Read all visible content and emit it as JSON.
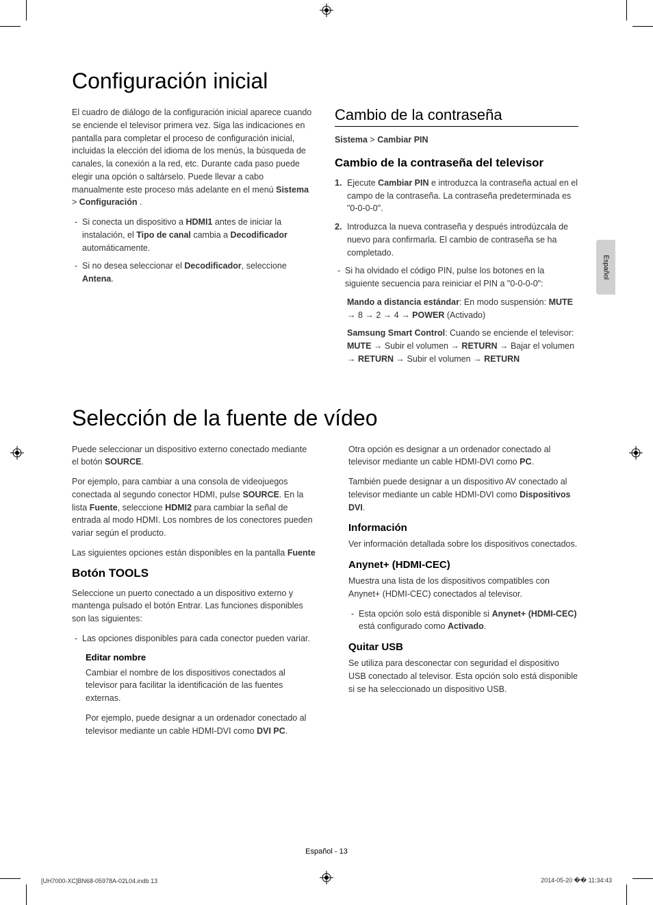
{
  "lang_tab": "Español",
  "section1": {
    "title": "Configuración inicial",
    "left": {
      "intro": "El cuadro de diálogo de la configuración inicial aparece cuando se enciende el televisor primera vez. Siga las indicaciones en pantalla para completar el proceso de configuración inicial, incluidas la elección del idioma de los menús, la búsqueda de canales, la conexión a la red, etc. Durante cada paso puede elegir una opción o saltárselo. Puede llevar a cabo manualmente este proceso más adelante en el menú ",
      "intro_b1": "Sistema",
      "intro_gt": " > ",
      "intro_b2": "Configuración",
      "intro_end": " .",
      "bullet1_a": "Si conecta un dispositivo a ",
      "bullet1_b1": "HDMI1",
      "bullet1_b": " antes de iniciar la instalación, el ",
      "bullet1_b2": "Tipo de canal",
      "bullet1_c": " cambia a ",
      "bullet1_b3": "Decodificador",
      "bullet1_d": " automáticamente.",
      "bullet2_a": "Si no desea seleccionar el ",
      "bullet2_b1": "Decodificador",
      "bullet2_b": ", seleccione ",
      "bullet2_b2": "Antena",
      "bullet2_c": "."
    },
    "right": {
      "h2": "Cambio de la contraseña",
      "crumb_a": "Sistema",
      "crumb_gt": " > ",
      "crumb_b": "Cambiar PIN",
      "h3": "Cambio de la contraseña del televisor",
      "step1_num": "1.",
      "step1_a": "Ejecute ",
      "step1_b1": "Cambiar PIN",
      "step1_b": " e introduzca la contraseña actual en el campo de la contraseña. La contraseña predeterminada es \"0-0-0-0\".",
      "step2_num": "2.",
      "step2_a": "Introduzca la nueva contraseña y después introdúzcala de nuevo para confirmarla. El cambio de contraseña se ha completado.",
      "bullet_a": "Si ha olvidado el código PIN, pulse los botones en la siguiente secuencia para reiniciar el PIN a \"0-0-0-0\":",
      "sub1_b1": "Mando a distancia estándar",
      "sub1_a": ": En modo suspensión: ",
      "sub1_b2": "MUTE",
      "sub1_b": " → 8 → 2 → 4 → ",
      "sub1_b3": "POWER",
      "sub1_c": " (Activado)",
      "sub2_b1": "Samsung Smart Control",
      "sub2_a": ": Cuando se enciende el televisor: ",
      "sub2_b2": "MUTE",
      "sub2_b": " → Subir el volumen → ",
      "sub2_b3": "RETURN",
      "sub2_c": " → Bajar el volumen → ",
      "sub2_b4": "RETURN",
      "sub2_d": " → Subir el volumen → ",
      "sub2_b5": "RETURN"
    }
  },
  "section2": {
    "title": "Selección de la fuente de vídeo",
    "left": {
      "p1_a": "Puede seleccionar un dispositivo externo conectado mediante el botón ",
      "p1_b1": "SOURCE",
      "p1_b": ".",
      "p2_a": "Por ejemplo, para cambiar a una consola de videojuegos conectada al segundo conector HDMI, pulse ",
      "p2_b1": "SOURCE",
      "p2_b": ". En la lista ",
      "p2_b2": "Fuente",
      "p2_c": ", seleccione ",
      "p2_b3": "HDMI2",
      "p2_d": " para cambiar la señal de entrada al modo HDMI. Los nombres de los conectores pueden variar según el producto.",
      "p3_a": "Las siguientes opciones están disponibles en la pantalla ",
      "p3_b1": "Fuente",
      "h3": "Botón TOOLS",
      "p4": "Seleccione un puerto conectado a un dispositivo externo y mantenga pulsado el botón Entrar. Las funciones disponibles son las siguientes:",
      "bullet1": "Las opciones disponibles para cada conector pueden variar.",
      "h5": "Editar nombre",
      "p5": "Cambiar el nombre de los dispositivos conectados al televisor para facilitar la identificación de las fuentes externas.",
      "p6_a": "Por ejemplo, puede designar a un ordenador conectado al televisor mediante un cable HDMI-DVI como ",
      "p6_b1": "DVI PC",
      "p6_b": "."
    },
    "right": {
      "p1_a": "Otra opción es designar a un ordenador conectado al televisor mediante un cable HDMI-DVI como ",
      "p1_b1": "PC",
      "p1_b": ".",
      "p2_a": "También puede designar a un dispositivo AV conectado al televisor mediante un cable HDMI-DVI como ",
      "p2_b1": "Dispositivos DVI",
      "p2_b": ".",
      "h4a": "Información",
      "p3": "Ver información detallada sobre los dispositivos conectados.",
      "h4b": "Anynet+ (HDMI-CEC)",
      "p4": "Muestra una lista de los dispositivos compatibles con Anynet+ (HDMI-CEC) conectados al televisor.",
      "bullet1_a": "Esta opción solo está disponible si ",
      "bullet1_b1": "Anynet+ (HDMI-CEC)",
      "bullet1_b": " está configurado como ",
      "bullet1_b2": "Activado",
      "bullet1_c": ".",
      "h4c": "Quitar USB",
      "p5": "Se utiliza para desconectar con seguridad el dispositivo USB conectado al televisor. Esta opción solo está disponible si se ha seleccionado un dispositivo USB."
    }
  },
  "footer": {
    "page": "Español - 13",
    "file": "[UH7000-XC]BN68-05978A-02L04.indb   13",
    "date": "2014-05-20   �� 11:34:43"
  }
}
